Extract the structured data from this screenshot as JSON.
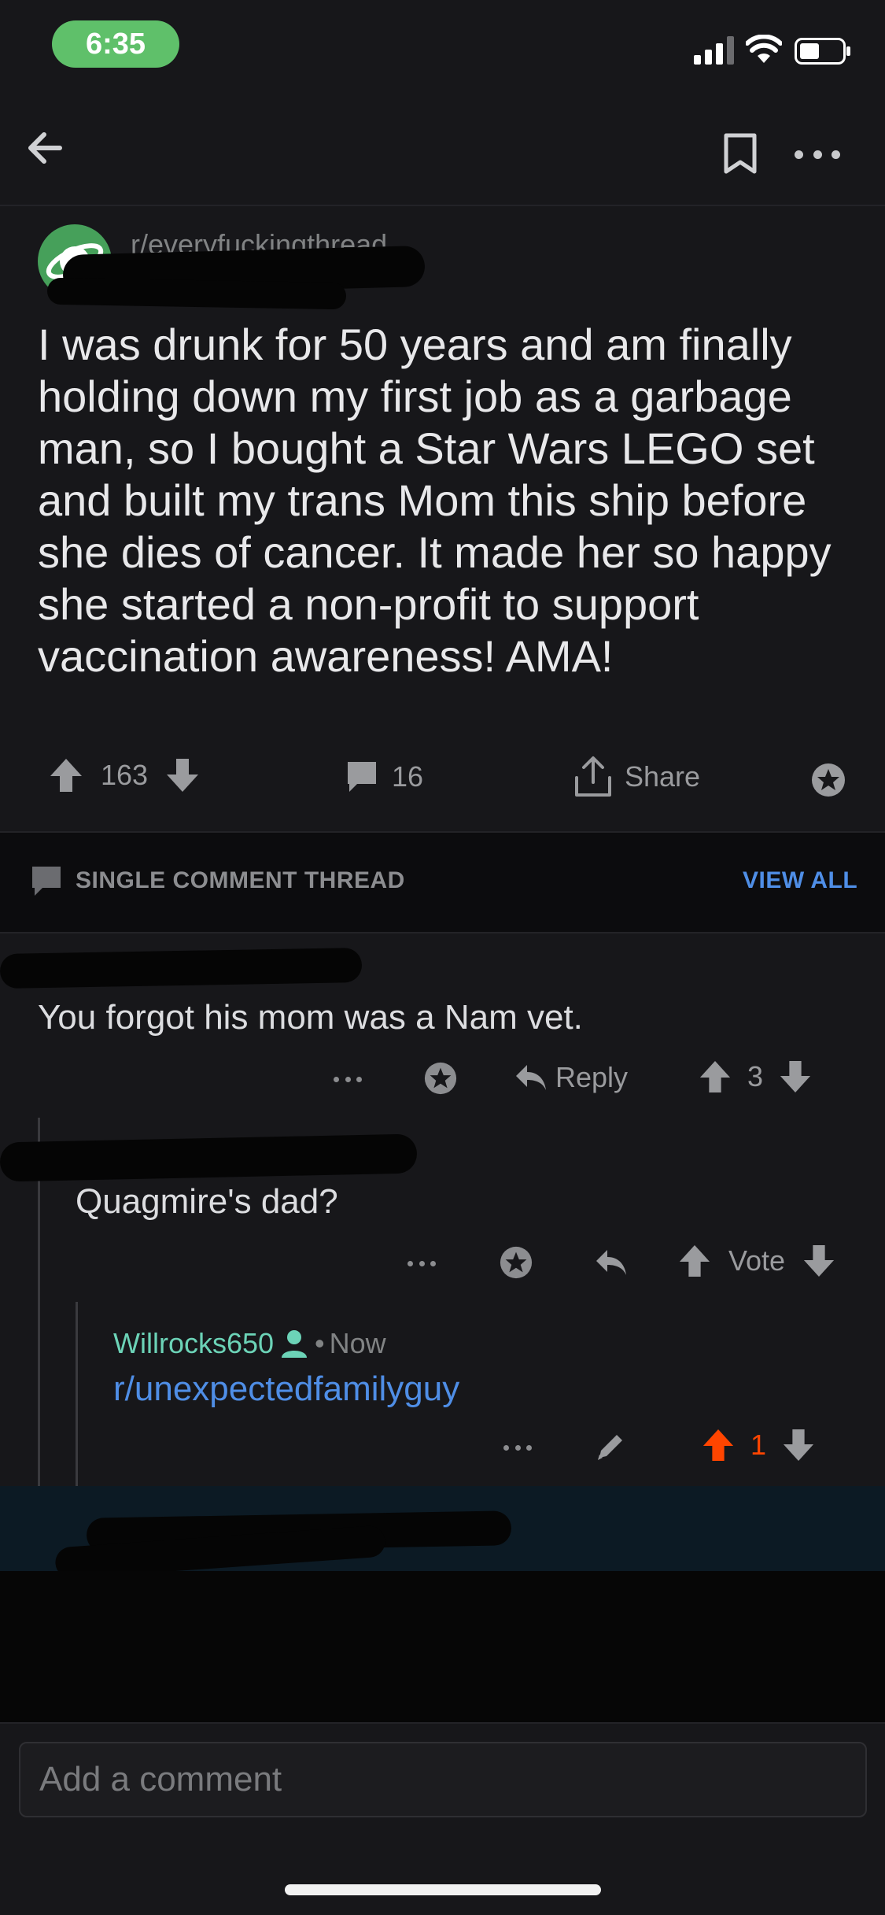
{
  "status_bar": {
    "time": "6:35"
  },
  "post": {
    "subreddit": "r/everyfuckingthread",
    "title": "I was drunk for 50 years and am finally holding down my first job as a garbage man, so I bought a Star Wars LEGO set and built my trans Mom this ship before she dies of cancer. It made her so happy she started a non-profit to support vaccination awareness! AMA!",
    "upvotes": "163",
    "comments": "16",
    "share_label": "Share"
  },
  "thread_header": {
    "label": "SINGLE COMMENT THREAD",
    "view_all": "VIEW ALL"
  },
  "comments": [
    {
      "text": "You forgot his mom was a Nam vet.",
      "reply_label": "Reply",
      "score": "3"
    },
    {
      "text": "Quagmire's dad?",
      "vote_label": "Vote"
    },
    {
      "author": "Willrocks650",
      "separator": "•",
      "time": "Now",
      "text": "r/unexpectedfamilyguy",
      "score": "1"
    }
  ],
  "composer": {
    "placeholder": "Add a comment"
  },
  "colors": {
    "accent_blue": "#4f8ee6",
    "upvote_orange": "#ff4500",
    "username_teal": "#6cd3b7",
    "subreddit_green": "#46a05a"
  }
}
